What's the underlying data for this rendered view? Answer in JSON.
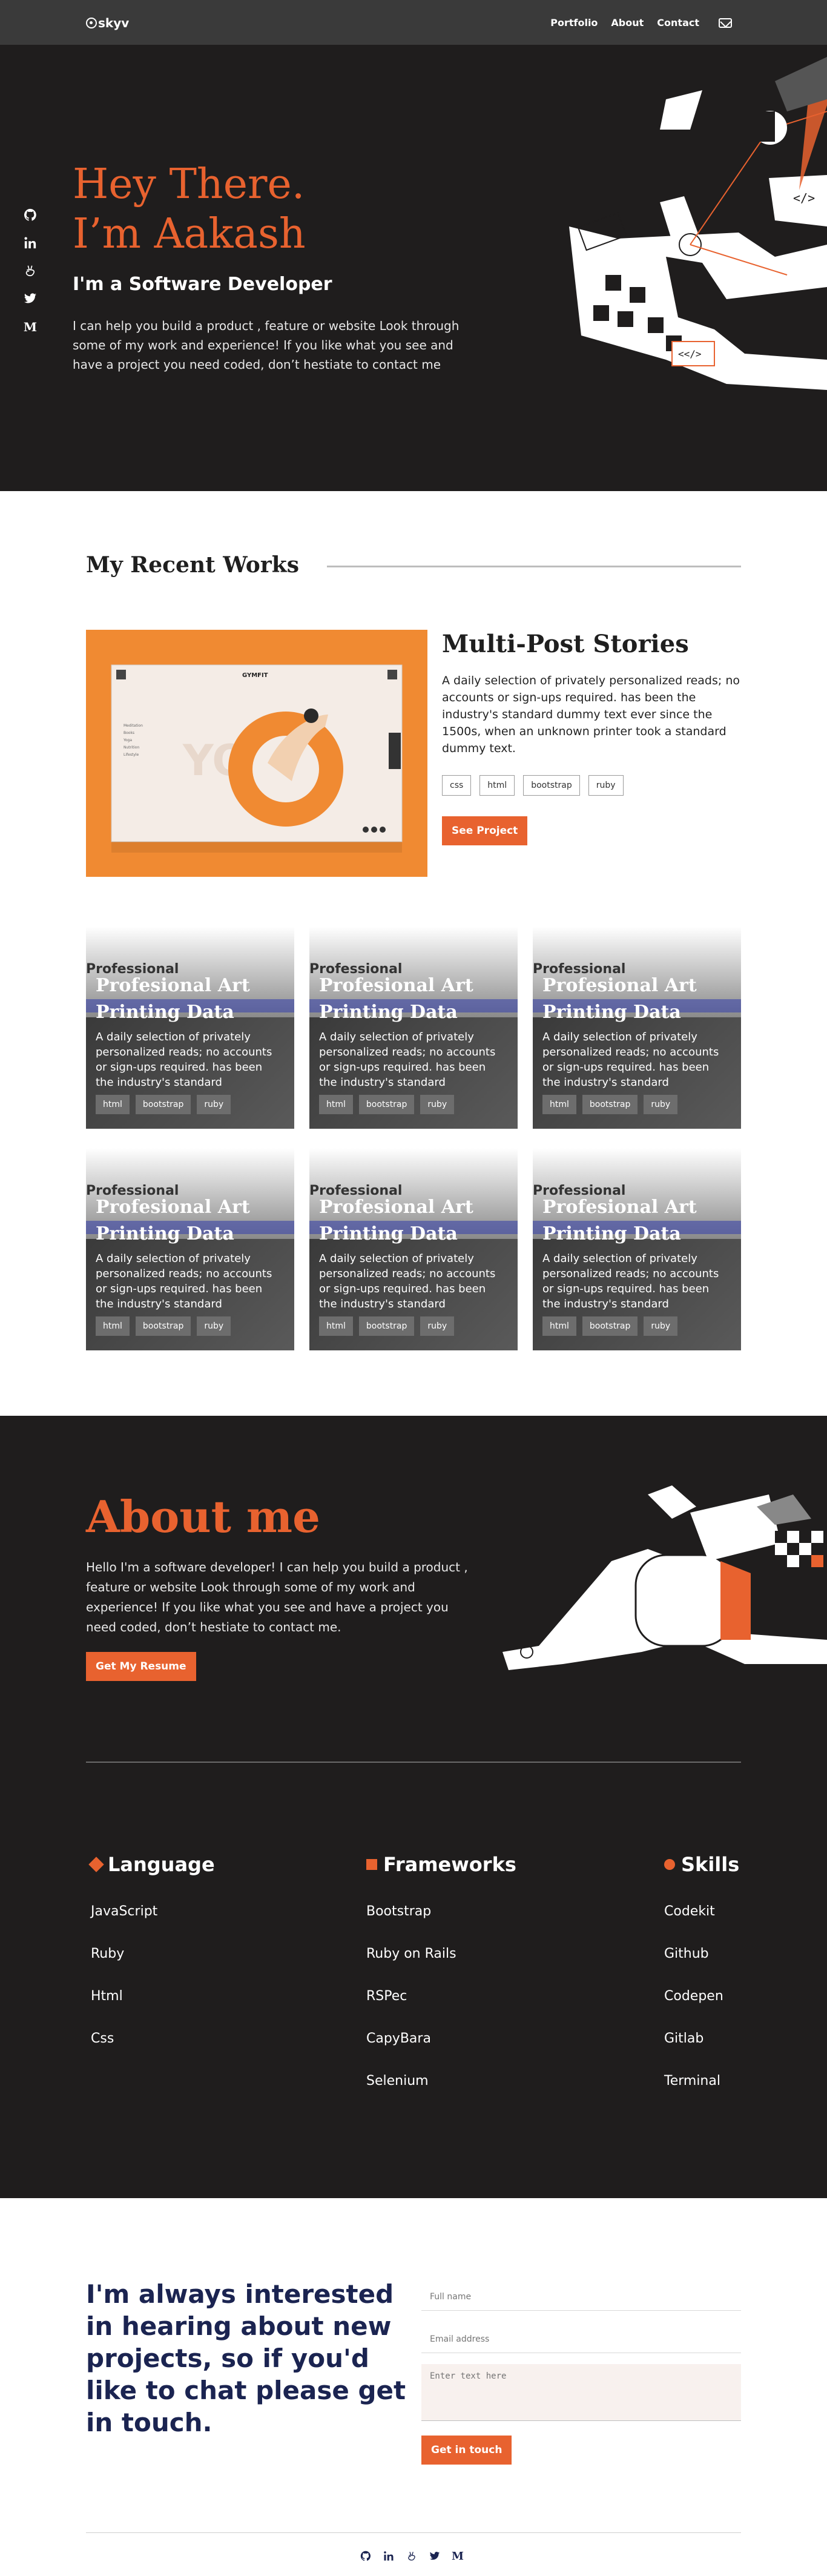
{
  "nav": {
    "logo": "skyv",
    "links": [
      "Portfolio",
      "About",
      "Contact"
    ]
  },
  "hero": {
    "line1": "Hey There.",
    "line2": "I’m Aakash",
    "subtitle": "I'm a Software Developer",
    "description": "I can help you build a product , feature or website Look through some of my work and experience! If you like what you see and have a project you need coded, don’t hestiate to contact me",
    "socials": [
      "github-icon",
      "linkedin-icon",
      "angellist-icon",
      "twitter-icon",
      "medium-icon"
    ],
    "art_labels": [
      "</>",
      "<</>"
    ]
  },
  "works": {
    "title": "My Recent Works",
    "featured": {
      "title": "Multi-Post Stories",
      "description": "A daily selection of privately personalized reads; no accounts or sign-ups required. has been the industry's standard dummy text ever since the 1500s, when an unknown printer took a standard dummy text.",
      "tags": [
        "css",
        "html",
        "bootstrap",
        "ruby"
      ],
      "button": "See Project",
      "mock_brand": "GYMFIT",
      "mock_bg_text": "YOGA",
      "mock_menu": [
        "Meditation",
        "Books",
        "Yoga",
        "Nutrition",
        "Lifestyle"
      ]
    },
    "card": {
      "bg_word": "Professional",
      "title": "Profesional Art Printing Data",
      "description": "A daily selection of privately personalized reads; no accounts or sign-ups required. has been the industry's standard",
      "tags": [
        "html",
        "bootstrap",
        "ruby"
      ]
    }
  },
  "about": {
    "title": "About me",
    "description": "Hello I'm a software developer! I can help you build a product , feature or website Look through some of my work and experience! If you like what you see and have a project you need coded, don’t hestiate to contact me.",
    "button": "Get My Resume",
    "language": {
      "title": "Language",
      "items": [
        "JavaScript",
        "Ruby",
        "Html",
        "Css"
      ]
    },
    "frameworks": {
      "title": "Frameworks",
      "items": [
        "Bootstrap",
        "Ruby on Rails",
        "RSPec",
        "CapyBara",
        "Selenium"
      ]
    },
    "skills": {
      "title": "Skills",
      "items": [
        "Codekit",
        "Github",
        "Codepen",
        "Gitlab",
        "Terminal"
      ]
    }
  },
  "contact": {
    "heading": "I'm always interested in hearing about new projects, so if you'd like to chat please get in touch.",
    "name_placeholder": "Full name",
    "email_placeholder": "Email address",
    "message_placeholder": "Enter text here",
    "button": "Get in touch"
  },
  "colors": {
    "accent": "#e8622f",
    "dark": "#1f1d1d",
    "nav": "#3a3a3a",
    "navy": "#1b2451"
  }
}
